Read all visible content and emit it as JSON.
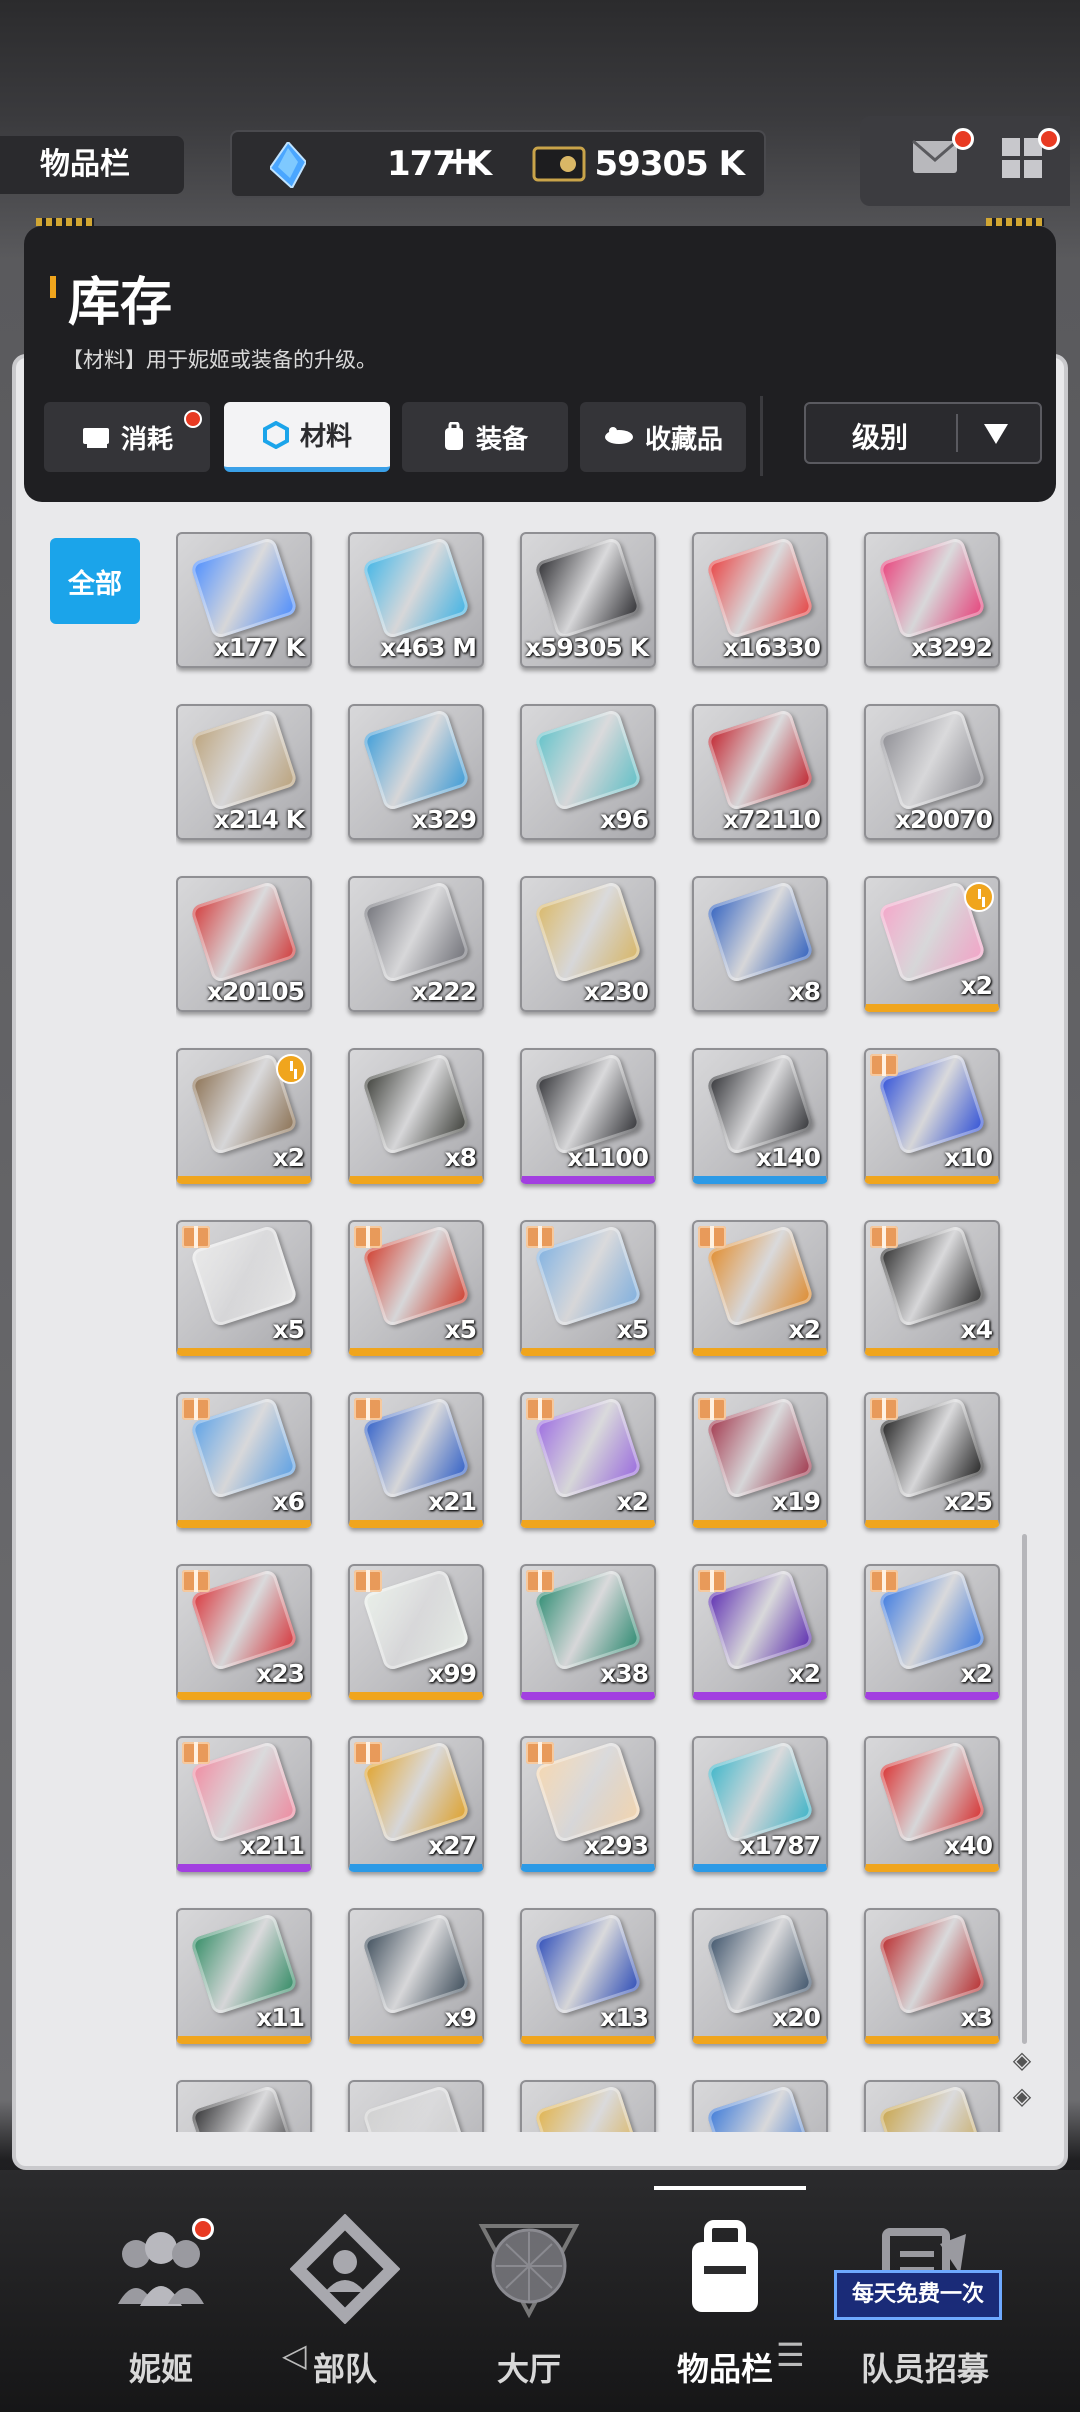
{
  "topbar": {
    "inventory_label": "物品栏",
    "gem_amount": "177 K",
    "plus": "+",
    "credit_amount": "59305 K"
  },
  "header": {
    "title": "库存",
    "subtitle": "【材料】用于妮姬或装备的升级。"
  },
  "tabs": [
    {
      "label": "消耗",
      "icon": "box-icon",
      "badge": true
    },
    {
      "label": "材料",
      "icon": "hexagon-icon",
      "active": true
    },
    {
      "label": "装备",
      "icon": "backpack-icon"
    },
    {
      "label": "收藏品",
      "icon": "treasure-icon"
    }
  ],
  "sort": {
    "label": "级别"
  },
  "filter_all": "全部",
  "items": [
    {
      "qty": "x177 K",
      "color": "#4a8cff",
      "rarity": "none"
    },
    {
      "qty": "x463 M",
      "color": "#3fb4e6",
      "rarity": "none"
    },
    {
      "qty": "x59305 K",
      "color": "#2a2a2e",
      "rarity": "none"
    },
    {
      "qty": "x16330",
      "color": "#e84040",
      "rarity": "none"
    },
    {
      "qty": "x3292",
      "color": "#e8407a",
      "rarity": "none"
    },
    {
      "qty": "x214 K",
      "color": "#bba27a",
      "rarity": "none"
    },
    {
      "qty": "x329",
      "color": "#3a9bd8",
      "rarity": "none"
    },
    {
      "qty": "x96",
      "color": "#5fc1c8",
      "rarity": "none"
    },
    {
      "qty": "x72110",
      "color": "#c1202b",
      "rarity": "none"
    },
    {
      "qty": "x20070",
      "color": "#8c8c92",
      "rarity": "none"
    },
    {
      "qty": "x20105",
      "color": "#d23838",
      "rarity": "none"
    },
    {
      "qty": "x222",
      "color": "#6f7077",
      "rarity": "none"
    },
    {
      "qty": "x230",
      "color": "#d9b766",
      "rarity": "none"
    },
    {
      "qty": "x8",
      "color": "#2e5fbf",
      "rarity": "none"
    },
    {
      "qty": "x2",
      "color": "#f4a4c8",
      "rarity": "gold",
      "timer": true
    },
    {
      "qty": "x2",
      "color": "#8a6f50",
      "rarity": "gold",
      "timer": true
    },
    {
      "qty": "x8",
      "color": "#3a3c36",
      "rarity": "gold"
    },
    {
      "qty": "x1100",
      "color": "#2e2f33",
      "rarity": "purple"
    },
    {
      "qty": "x140",
      "color": "#2e2f33",
      "rarity": "blue"
    },
    {
      "qty": "x10",
      "color": "#2d4ed8",
      "rarity": "gold",
      "gift": true
    },
    {
      "qty": "x5",
      "color": "#e8e8e8",
      "rarity": "gold",
      "gift": true
    },
    {
      "qty": "x5",
      "color": "#d03a2a",
      "rarity": "gold",
      "gift": true
    },
    {
      "qty": "x5",
      "color": "#7fb0e0",
      "rarity": "gold",
      "gift": true
    },
    {
      "qty": "x2",
      "color": "#e08a2a",
      "rarity": "gold",
      "gift": true
    },
    {
      "qty": "x4",
      "color": "#2c2c2c",
      "rarity": "gold",
      "gift": true
    },
    {
      "qty": "x6",
      "color": "#5aa0e6",
      "rarity": "gold",
      "gift": true
    },
    {
      "qty": "x21",
      "color": "#2e5ec8",
      "rarity": "gold",
      "gift": true
    },
    {
      "qty": "x2",
      "color": "#9a6ae0",
      "rarity": "gold",
      "gift": true
    },
    {
      "qty": "x19",
      "color": "#a0344a",
      "rarity": "gold",
      "gift": true
    },
    {
      "qty": "x25",
      "color": "#1f1f1f",
      "rarity": "gold",
      "gift": true
    },
    {
      "qty": "x23",
      "color": "#d8343a",
      "rarity": "gold",
      "gift": true
    },
    {
      "qty": "x99",
      "color": "#e8eee8",
      "rarity": "gold",
      "gift": true
    },
    {
      "qty": "x38",
      "color": "#2a8a70",
      "rarity": "purple",
      "gift": true
    },
    {
      "qty": "x2",
      "color": "#5a2ab0",
      "rarity": "purple",
      "gift": true
    },
    {
      "qty": "x2",
      "color": "#3a78e0",
      "rarity": "purple",
      "gift": true
    },
    {
      "qty": "x211",
      "color": "#f08aa0",
      "rarity": "purple",
      "gift": true
    },
    {
      "qty": "x27",
      "color": "#e0a22a",
      "rarity": "blue",
      "gift": true
    },
    {
      "qty": "x293",
      "color": "#f4d6b0",
      "rarity": "blue",
      "gift": true
    },
    {
      "qty": "x1787",
      "color": "#3ab4c8",
      "rarity": "blue"
    },
    {
      "qty": "x40",
      "color": "#d82e2e",
      "rarity": "gold"
    },
    {
      "qty": "x11",
      "color": "#2e8a62",
      "rarity": "gold"
    },
    {
      "qty": "x9",
      "color": "#3a4a58",
      "rarity": "gold"
    },
    {
      "qty": "x13",
      "color": "#2a4ab8",
      "rarity": "gold"
    },
    {
      "qty": "x20",
      "color": "#3a5068",
      "rarity": "gold"
    },
    {
      "qty": "x3",
      "color": "#b8282a",
      "rarity": "gold"
    },
    {
      "qty": "",
      "color": "#2e2e30",
      "rarity": "none"
    },
    {
      "qty": "",
      "color": "#d0d0d0",
      "rarity": "none"
    },
    {
      "qty": "",
      "color": "#e0b24a",
      "rarity": "none"
    },
    {
      "qty": "",
      "color": "#3a78d8",
      "rarity": "none"
    },
    {
      "qty": "",
      "color": "#c8a44a",
      "rarity": "none"
    }
  ],
  "nav": [
    {
      "label": "妮姬",
      "icon": "people-icon",
      "badge": true
    },
    {
      "label": "部队",
      "icon": "squad-icon"
    },
    {
      "label": "大厅",
      "icon": "lobby-icon"
    },
    {
      "label": "物品栏",
      "icon": "inventory-icon",
      "active": true
    },
    {
      "label": "队员招募",
      "icon": "recruit-icon"
    }
  ],
  "free_badge": "每天免费一次",
  "colors": {
    "accent": "#1ba4ea",
    "gold": "#f0a51d",
    "purple": "#a23fe0",
    "blue": "#2c9ae6",
    "badge_red": "#e83a22"
  }
}
